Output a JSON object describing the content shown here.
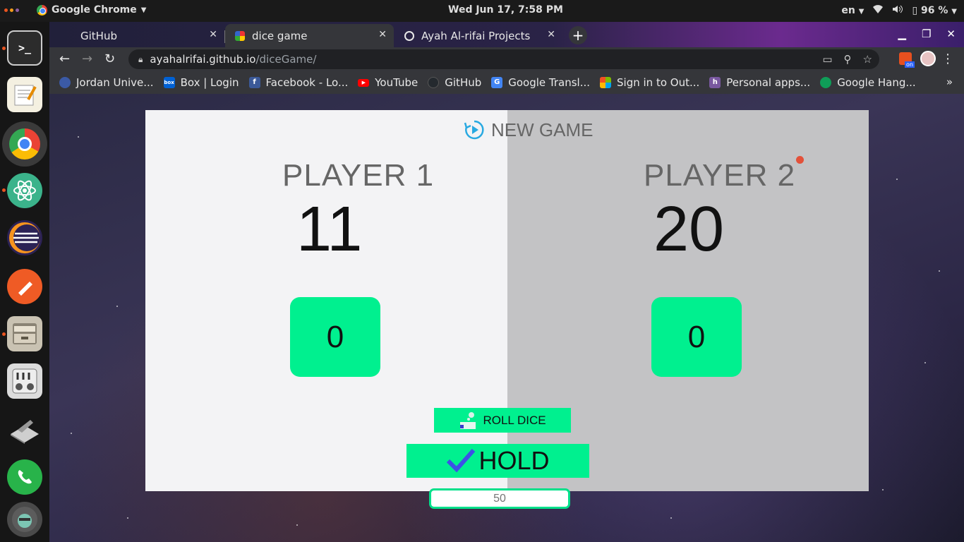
{
  "system": {
    "app_name": "Google Chrome",
    "clock": "Wed Jun 17,  7:58 PM",
    "keyboard_layout": "en",
    "battery": "96 %",
    "colors": {
      "dot_red": "#e95420",
      "dot_orange": "#f49c1b",
      "dot_purple": "#8f5ea2"
    }
  },
  "dock": {
    "items": [
      "terminal-icon",
      "text-editor-icon",
      "chrome-icon",
      "atom-icon",
      "eclipse-icon",
      "postman-icon",
      "files-icon",
      "mixer-icon",
      "settings-tools-icon",
      "phone-icon",
      "user-avatar-icon"
    ]
  },
  "browser": {
    "tabs": [
      {
        "label": "GitHub",
        "active": false
      },
      {
        "label": "dice game",
        "active": true
      },
      {
        "label": "Ayah Al-rifai Projects",
        "active": false
      }
    ],
    "url_host": "ayahalrifai.github.io",
    "url_path": "/diceGame/",
    "bookmarks": [
      {
        "label": "Jordan Unive...",
        "icon": "ju-icon",
        "color": "#3b5aa6"
      },
      {
        "label": "Box | Login",
        "icon": "box-icon",
        "color": "#0061d5"
      },
      {
        "label": "Facebook - Lo...",
        "icon": "facebook-icon",
        "color": "#3b5998"
      },
      {
        "label": "YouTube",
        "icon": "youtube-icon",
        "color": "#ff0000"
      },
      {
        "label": "GitHub",
        "icon": "github-icon",
        "color": "#24292e"
      },
      {
        "label": "Google Transl...",
        "icon": "google-translate-icon",
        "color": "#4285f4"
      },
      {
        "label": "Sign in to Out...",
        "icon": "microsoft-icon",
        "color": "#f25022"
      },
      {
        "label": "Personal apps...",
        "icon": "heroku-icon",
        "color": "#79589f"
      },
      {
        "label": "Google Hang...",
        "icon": "hangouts-icon",
        "color": "#0f9d58"
      }
    ]
  },
  "game": {
    "new_game_label": "NEW GAME",
    "players": [
      {
        "name": "PLAYER 1",
        "score": "11",
        "current": "0"
      },
      {
        "name": "PLAYER 2",
        "score": "20",
        "current": "0"
      }
    ],
    "active_player": 2,
    "roll_label": "ROLL DICE",
    "hold_label": "HOLD",
    "final_score_placeholder": "50",
    "accent_color": "#00f08f",
    "active_dot_color": "#e3513a"
  }
}
